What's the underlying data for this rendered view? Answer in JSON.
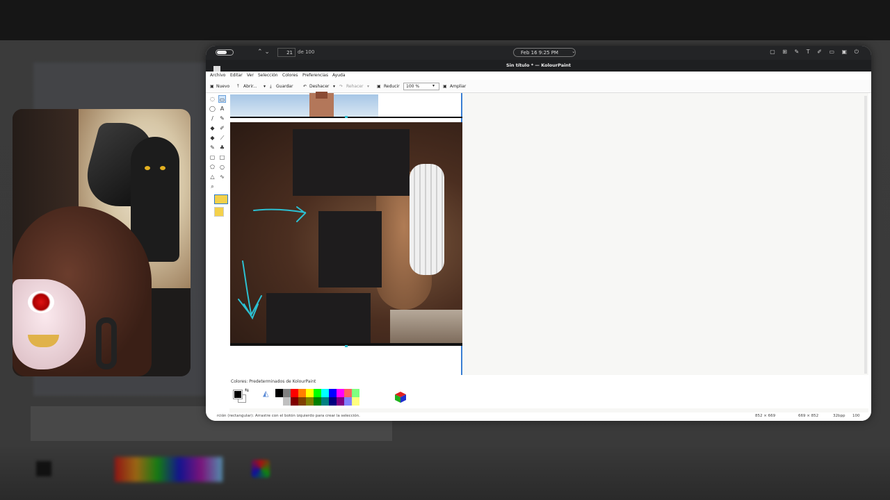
{
  "window": {
    "topbar": {
      "page_current": "21",
      "page_total": "de 100",
      "date_time": "Feb 16   9:25 PM",
      "sys_icons": "▢ ⊞ ✎ T ✐ ▭ ▣ ⏻"
    },
    "title": "Sin título * — KolourPaint",
    "menu": [
      "Archivo",
      "Editar",
      "Ver",
      "Selección",
      "Colores",
      "Preferencias",
      "Ayuda"
    ],
    "toolbar": {
      "new_label": "Nuevo",
      "open_label": "Abrir...",
      "save_label": "Guardar",
      "undo_label": "Deshacer",
      "redo_label": "Rehacer",
      "zoom_out_label": "Reducir",
      "zoom_value": "100 %",
      "zoom_in_label": "Ampliar"
    },
    "palette_label": "Colores: Predeterminados de KolourPaint",
    "palette_colors": [
      "#000000",
      "#808080",
      "#ff0000",
      "#ff7f00",
      "#ffff00",
      "#00ff00",
      "#00ffff",
      "#0000ff",
      "#ff00ff",
      "#ff6060",
      "#80ff80",
      "#ffffff",
      "#ffffff",
      "#ffffff",
      "#c0c0c0",
      "#800000",
      "#804000",
      "#808000",
      "#008000",
      "#008080",
      "#000080",
      "#800080",
      "#8080ff",
      "#ffff80",
      "#ffffff",
      "#ffffff"
    ],
    "status": {
      "message": "rción (rectangular): Arrastre con el botón izquierdo para crear la selección.",
      "dims1": "852 × 669",
      "dims2": "669 × 852",
      "depth": "32bpp",
      "zoom": "100"
    }
  },
  "accent_colors": {
    "selection": "#3a7fd4",
    "annotation": "#2cc0d2"
  }
}
